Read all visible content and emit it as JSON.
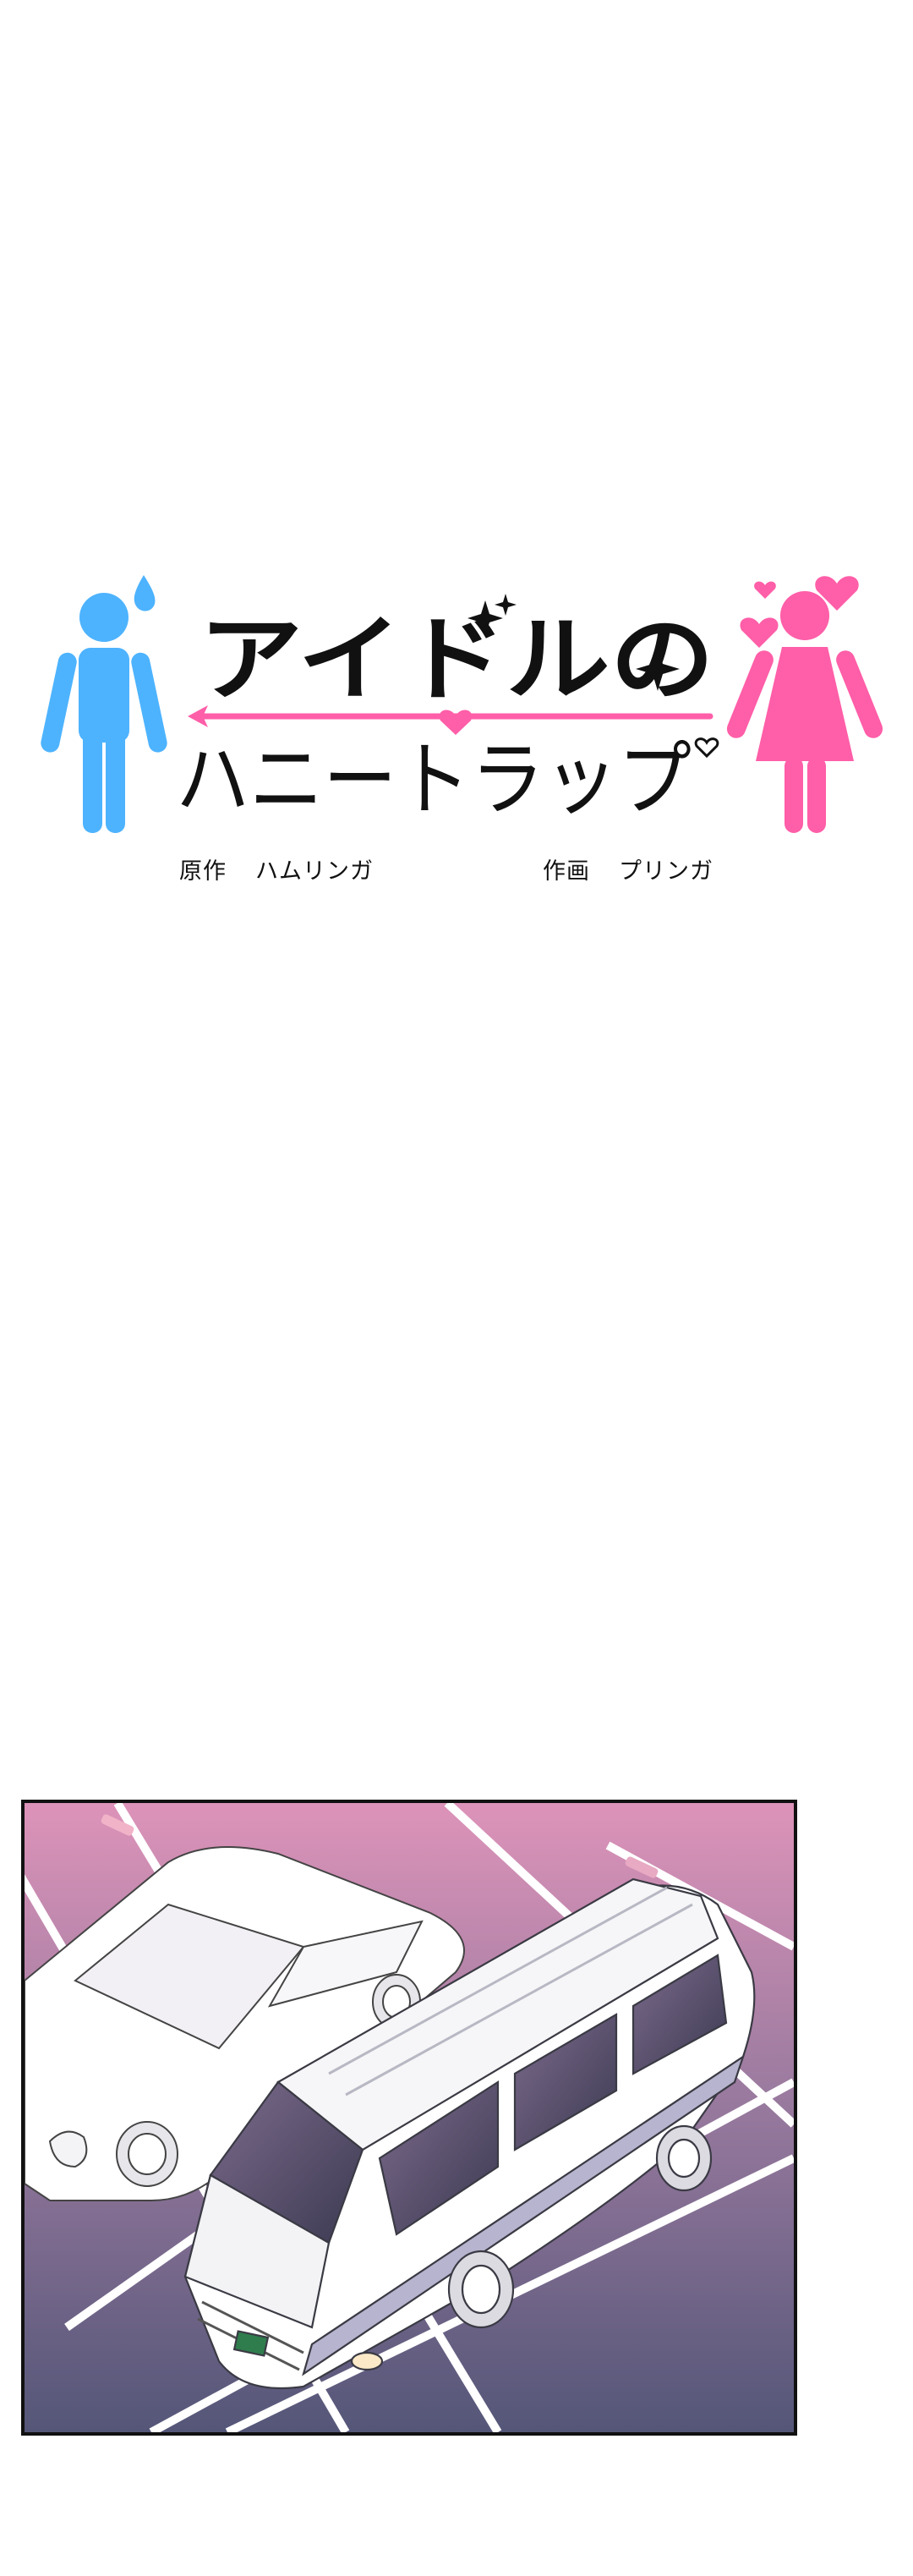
{
  "title": {
    "main": "アイドルの",
    "sub": "ハニートラップ"
  },
  "credits": {
    "story_role": "原作",
    "story_name": "ハムリンガ",
    "art_role": "作画",
    "art_name": "プリンガ"
  },
  "colors": {
    "male_figure": "#4db3ff",
    "female_figure": "#ff5ea8",
    "title_text": "#111111",
    "panel_sky_top": "#d88fb5",
    "panel_ground_bottom": "#555877"
  },
  "icons": [
    "male-figure-icon",
    "sweat-drop-icon",
    "female-figure-icon",
    "heart-icon",
    "sparkle-icon"
  ]
}
